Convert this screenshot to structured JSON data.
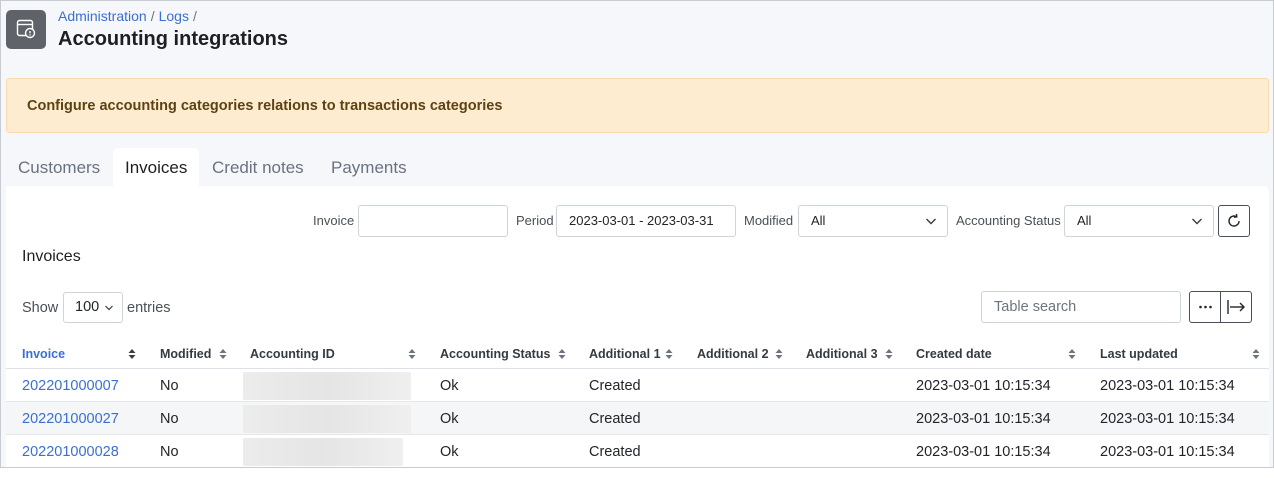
{
  "header": {
    "breadcrumb": [
      "Administration",
      "Logs"
    ],
    "separator": "/",
    "title": "Accounting integrations",
    "icon": "invoice-settings-icon"
  },
  "alert": {
    "text": "Configure accounting categories relations to transactions categories"
  },
  "tabs": [
    {
      "label": "Customers",
      "active": false
    },
    {
      "label": "Invoices",
      "active": true
    },
    {
      "label": "Credit notes",
      "active": false
    },
    {
      "label": "Payments",
      "active": false
    }
  ],
  "filters": {
    "invoice_label": "Invoice",
    "invoice_value": "",
    "period_label": "Period",
    "period_value": "2023-03-01 - 2023-03-31",
    "modified_label": "Modified",
    "modified_value": "All",
    "status_label": "Accounting Status",
    "status_value": "All"
  },
  "section_title": "Invoices",
  "table_controls": {
    "show_label": "Show",
    "page_length": "100",
    "entries_label": "entries",
    "search_placeholder": "Table search",
    "more_icon": "ellipsis-icon",
    "export_icon": "arrow-to-line-icon"
  },
  "table": {
    "columns": [
      "Invoice",
      "Modified",
      "Accounting ID",
      "Accounting Status",
      "Additional 1",
      "Additional 2",
      "Additional 3",
      "Created date",
      "Last updated"
    ],
    "rows": [
      {
        "invoice": "202201000007",
        "modified": "No",
        "accounting_id": "",
        "status": "Ok",
        "additional_1": "Created",
        "additional_2": "",
        "additional_3": "",
        "created": "2023-03-01 10:15:34",
        "updated": "2023-03-01 10:15:34"
      },
      {
        "invoice": "202201000027",
        "modified": "No",
        "accounting_id": "",
        "status": "Ok",
        "additional_1": "Created",
        "additional_2": "",
        "additional_3": "",
        "created": "2023-03-01 10:15:34",
        "updated": "2023-03-01 10:15:34"
      },
      {
        "invoice": "202201000028",
        "modified": "No",
        "accounting_id": "",
        "status": "Ok",
        "additional_1": "Created",
        "additional_2": "",
        "additional_3": "",
        "created": "2023-03-01 10:15:34",
        "updated": "2023-03-01 10:15:34"
      }
    ]
  },
  "colors": {
    "link": "#3b6fd1",
    "alert_bg": "#fdecd0",
    "alert_text": "#5d4313",
    "icon_bg": "#5f6369"
  }
}
